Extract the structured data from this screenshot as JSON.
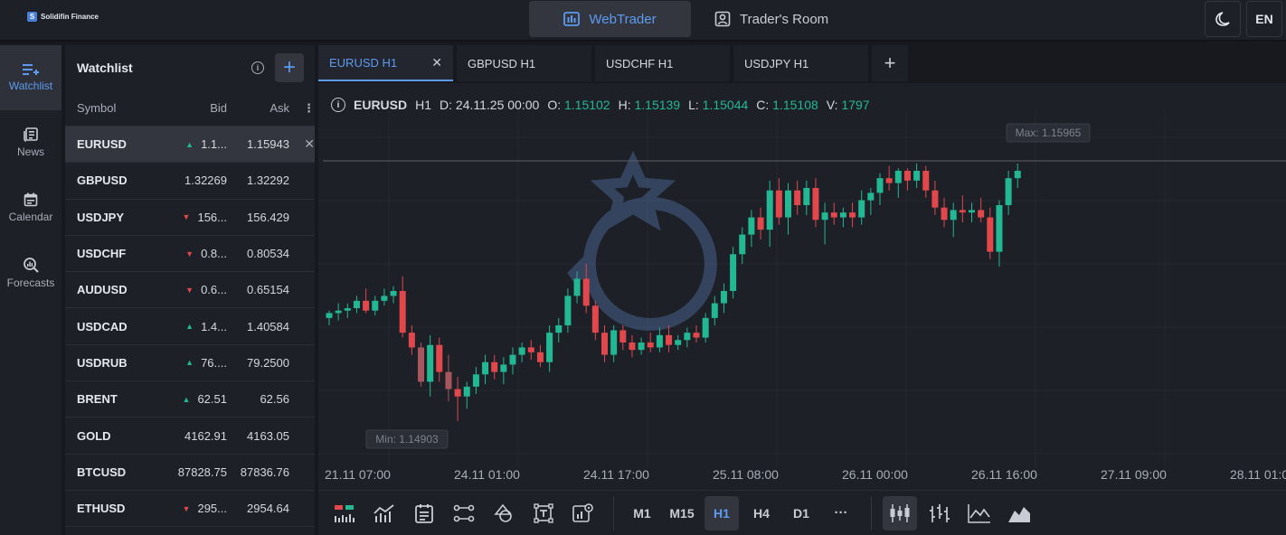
{
  "brand": {
    "name": "Solidifin Finance"
  },
  "topnav": [
    {
      "label": "WebTrader",
      "icon": "chart-window-icon",
      "active": true
    },
    {
      "label": "Trader's Room",
      "icon": "user-badge-icon",
      "active": false
    }
  ],
  "topright": {
    "lang": "EN"
  },
  "leftnav": [
    {
      "label": "Watchlist",
      "icon": "watchlist-icon",
      "active": true
    },
    {
      "label": "News",
      "icon": "news-icon",
      "active": false
    },
    {
      "label": "Calendar",
      "icon": "calendar-icon",
      "active": false
    },
    {
      "label": "Forecasts",
      "icon": "forecasts-icon",
      "active": false
    }
  ],
  "watchlist": {
    "title": "Watchlist",
    "columns": {
      "symbol": "Symbol",
      "bid": "Bid",
      "ask": "Ask"
    },
    "rows": [
      {
        "symbol": "EURUSD",
        "dir": "up",
        "bid": "1.1...",
        "ask": "1.15943",
        "selected": true
      },
      {
        "symbol": "GBPUSD",
        "dir": "",
        "bid": "1.32269",
        "ask": "1.32292"
      },
      {
        "symbol": "USDJPY",
        "dir": "down",
        "bid": "156...",
        "ask": "156.429"
      },
      {
        "symbol": "USDCHF",
        "dir": "down",
        "bid": "0.8...",
        "ask": "0.80534"
      },
      {
        "symbol": "AUDUSD",
        "dir": "down",
        "bid": "0.6...",
        "ask": "0.65154"
      },
      {
        "symbol": "USDCAD",
        "dir": "up",
        "bid": "1.4...",
        "ask": "1.40584"
      },
      {
        "symbol": "USDRUB",
        "dir": "up",
        "bid": "76....",
        "ask": "79.2500"
      },
      {
        "symbol": "BRENT",
        "dir": "up",
        "bid": "62.51",
        "ask": "62.56"
      },
      {
        "symbol": "GOLD",
        "dir": "",
        "bid": "4162.91",
        "ask": "4163.05"
      },
      {
        "symbol": "BTCUSD",
        "dir": "",
        "bid": "87828.75",
        "ask": "87836.76"
      },
      {
        "symbol": "ETHUSD",
        "dir": "down",
        "bid": "295...",
        "ask": "2954.64"
      }
    ]
  },
  "tabs": [
    {
      "label": "EURUSD H1",
      "active": true
    },
    {
      "label": "GBPUSD H1",
      "active": false
    },
    {
      "label": "USDCHF H1",
      "active": false
    },
    {
      "label": "USDJPY H1",
      "active": false
    }
  ],
  "legend": {
    "symbol": "EURUSD",
    "tf": "H1",
    "d_label": "D:",
    "d_value": "24.11.25 00:00",
    "o_label": "O:",
    "o_value": "1.15102",
    "h_label": "H:",
    "h_value": "1.15139",
    "l_label": "L:",
    "l_value": "1.15044",
    "c_label": "C:",
    "c_value": "1.15108",
    "v_label": "V:",
    "v_value": "1797"
  },
  "chart_data": {
    "type": "candlestick",
    "max_label": "Max: 1.15965",
    "min_label": "Min: 1.14903",
    "ylim": [
      1.1475,
      1.1615
    ],
    "xticks": [
      "21.11 07:00",
      "24.11 01:00",
      "24.11 17:00",
      "25.11 08:00",
      "26.11 00:00",
      "26.11 16:00",
      "27.11 09:00",
      "28.11 01:00"
    ],
    "colors": {
      "up": "#22b894",
      "down": "#e2474c",
      "faded_down": "#a8565d"
    },
    "candles": [
      [
        1.1534,
        1.1537,
        1.1531,
        1.1536
      ],
      [
        1.1536,
        1.154,
        1.1533,
        1.1537
      ],
      [
        1.1537,
        1.154,
        1.1534,
        1.1538
      ],
      [
        1.1538,
        1.1543,
        1.1536,
        1.1541
      ],
      [
        1.1541,
        1.1546,
        1.1536,
        1.1537
      ],
      [
        1.1537,
        1.1543,
        1.1535,
        1.1541
      ],
      [
        1.1541,
        1.1546,
        1.1539,
        1.1543
      ],
      [
        1.1543,
        1.1547,
        1.154,
        1.1545
      ],
      [
        1.1545,
        1.1551,
        1.1526,
        1.1528
      ],
      [
        1.1528,
        1.1531,
        1.1519,
        1.1522
      ],
      [
        1.1522,
        1.1524,
        1.1506,
        1.1508
      ],
      [
        1.1508,
        1.1527,
        1.1502,
        1.1523
      ],
      [
        1.1523,
        1.1526,
        1.1508,
        1.1512
      ],
      [
        1.1512,
        1.1519,
        1.15,
        1.1505
      ],
      [
        1.1505,
        1.151,
        1.1492,
        1.1502
      ],
      [
        1.1502,
        1.1508,
        1.1497,
        1.1506
      ],
      [
        1.1506,
        1.1514,
        1.1503,
        1.1511
      ],
      [
        1.1511,
        1.1519,
        1.1507,
        1.1516
      ],
      [
        1.1516,
        1.1519,
        1.1509,
        1.1512
      ],
      [
        1.1512,
        1.1518,
        1.1507,
        1.1515
      ],
      [
        1.1515,
        1.1522,
        1.1511,
        1.1519
      ],
      [
        1.1519,
        1.1524,
        1.1516,
        1.1522
      ],
      [
        1.1522,
        1.1525,
        1.1517,
        1.152
      ],
      [
        1.152,
        1.1523,
        1.1514,
        1.1516
      ],
      [
        1.1516,
        1.1531,
        1.1512,
        1.1528
      ],
      [
        1.1528,
        1.1534,
        1.1524,
        1.1531
      ],
      [
        1.1531,
        1.1546,
        1.1528,
        1.1543
      ],
      [
        1.1543,
        1.1553,
        1.154,
        1.155
      ],
      [
        1.155,
        1.1556,
        1.1536,
        1.1539
      ],
      [
        1.1539,
        1.1541,
        1.1525,
        1.1528
      ],
      [
        1.1528,
        1.1531,
        1.1516,
        1.1519
      ],
      [
        1.1519,
        1.1531,
        1.1516,
        1.1529
      ],
      [
        1.1529,
        1.1531,
        1.1521,
        1.1524
      ],
      [
        1.1524,
        1.1527,
        1.1518,
        1.1521
      ],
      [
        1.1521,
        1.1526,
        1.1519,
        1.1524
      ],
      [
        1.1524,
        1.1528,
        1.152,
        1.1522
      ],
      [
        1.1522,
        1.153,
        1.152,
        1.1527
      ],
      [
        1.1527,
        1.1531,
        1.152,
        1.1523
      ],
      [
        1.1523,
        1.1527,
        1.1521,
        1.1525
      ],
      [
        1.1525,
        1.153,
        1.1522,
        1.1528
      ],
      [
        1.1528,
        1.1531,
        1.1524,
        1.1526
      ],
      [
        1.1526,
        1.1536,
        1.1524,
        1.1534
      ],
      [
        1.1534,
        1.1543,
        1.1531,
        1.154
      ],
      [
        1.154,
        1.1548,
        1.1536,
        1.1545
      ],
      [
        1.1545,
        1.1563,
        1.1542,
        1.156
      ],
      [
        1.156,
        1.1571,
        1.1556,
        1.1568
      ],
      [
        1.1568,
        1.1578,
        1.1563,
        1.1575
      ],
      [
        1.1575,
        1.1579,
        1.1566,
        1.157
      ],
      [
        1.157,
        1.159,
        1.1563,
        1.1586
      ],
      [
        1.1586,
        1.1591,
        1.1572,
        1.1575
      ],
      [
        1.1575,
        1.1589,
        1.1568,
        1.1586
      ],
      [
        1.1586,
        1.159,
        1.1576,
        1.158
      ],
      [
        1.158,
        1.159,
        1.1576,
        1.1587
      ],
      [
        1.1587,
        1.1591,
        1.1571,
        1.1574
      ],
      [
        1.1574,
        1.1581,
        1.1564,
        1.1577
      ],
      [
        1.1577,
        1.1581,
        1.1572,
        1.1575
      ],
      [
        1.1575,
        1.1579,
        1.1571,
        1.1577
      ],
      [
        1.1577,
        1.1581,
        1.1571,
        1.1575
      ],
      [
        1.1575,
        1.1586,
        1.1572,
        1.1582
      ],
      [
        1.1582,
        1.1587,
        1.1576,
        1.1585
      ],
      [
        1.1585,
        1.1593,
        1.158,
        1.1591
      ],
      [
        1.1591,
        1.1596,
        1.1586,
        1.1589
      ],
      [
        1.1589,
        1.1595,
        1.1583,
        1.1594
      ],
      [
        1.1594,
        1.1595,
        1.1586,
        1.159
      ],
      [
        1.159,
        1.1597,
        1.1587,
        1.1594
      ],
      [
        1.1594,
        1.1596,
        1.1583,
        1.1586
      ],
      [
        1.1586,
        1.159,
        1.1576,
        1.1579
      ],
      [
        1.1579,
        1.1583,
        1.1571,
        1.1574
      ],
      [
        1.1574,
        1.1581,
        1.1567,
        1.1578
      ],
      [
        1.1578,
        1.1584,
        1.1573,
        1.1577
      ],
      [
        1.1577,
        1.1581,
        1.1573,
        1.1578
      ],
      [
        1.1578,
        1.1583,
        1.1573,
        1.1575
      ],
      [
        1.1575,
        1.1579,
        1.1558,
        1.1561
      ],
      [
        1.1561,
        1.1582,
        1.1555,
        1.158
      ],
      [
        1.158,
        1.1594,
        1.1576,
        1.1591
      ],
      [
        1.1591,
        1.1597,
        1.1587,
        1.1594
      ]
    ]
  },
  "bottombar": {
    "timeframes": [
      "M1",
      "M15",
      "H1",
      "H4",
      "D1"
    ],
    "active_tf": "H1",
    "more": "···"
  }
}
